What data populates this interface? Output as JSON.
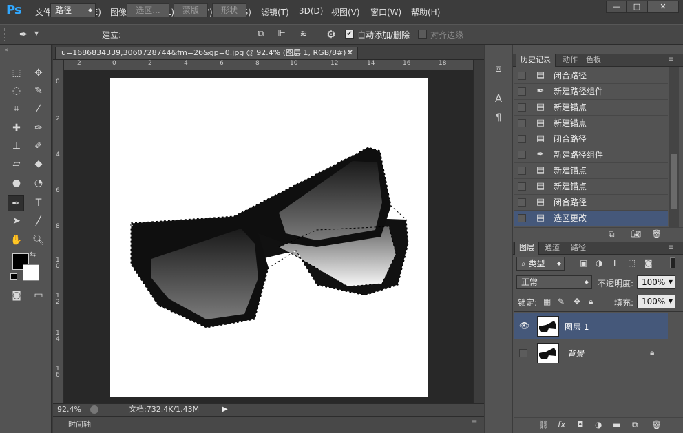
{
  "app": {
    "logo": "Ps"
  },
  "menu": [
    "文件(F)",
    "编辑(E)",
    "图像(I)",
    "图层(L)",
    "文字(Y)",
    "选择(S)",
    "滤镜(T)",
    "3D(D)",
    "视图(V)",
    "窗口(W)",
    "帮助(H)"
  ],
  "window_controls": {
    "minimize": "—",
    "maximize": "□",
    "close": "✕"
  },
  "options": {
    "mode_select": "路径",
    "make_label": "建立:",
    "selection_btn": "选区...",
    "mask_btn": "蒙版",
    "shape_btn": "形状",
    "auto_add_delete": "自动添加/删除",
    "align_edges": "对齐边缘"
  },
  "document": {
    "tab_title": "u=1686834339,3060728744&fm=26&gp=0.jpg @ 92.4% (图层 1, RGB/8#) *",
    "ruler_h_ticks": [
      "2",
      "0",
      "2",
      "4",
      "6",
      "8",
      "10",
      "12",
      "14",
      "16",
      "18"
    ],
    "ruler_v_ticks": [
      "0",
      "2",
      "4",
      "6",
      "8",
      "1 0",
      "1 2",
      "1 4",
      "1 6"
    ],
    "zoom": "92.4%",
    "doc_size": "文档:732.4K/1.43M",
    "timeline_label": "时间轴"
  },
  "history": {
    "tabs": [
      "历史记录",
      "动作",
      "色板"
    ],
    "items": [
      {
        "icon": "doc-icon",
        "label": "闭合路径"
      },
      {
        "icon": "pen-icon",
        "label": "新建路径组件"
      },
      {
        "icon": "doc-icon",
        "label": "新建锚点"
      },
      {
        "icon": "doc-icon",
        "label": "新建锚点"
      },
      {
        "icon": "doc-icon",
        "label": "闭合路径"
      },
      {
        "icon": "pen-icon",
        "label": "新建路径组件"
      },
      {
        "icon": "doc-icon",
        "label": "新建锚点"
      },
      {
        "icon": "doc-icon",
        "label": "新建锚点"
      },
      {
        "icon": "doc-icon",
        "label": "闭合路径"
      },
      {
        "icon": "doc-icon",
        "label": "选区更改"
      }
    ],
    "selected_index": 9
  },
  "layers": {
    "tabs": [
      "图层",
      "通道",
      "路径"
    ],
    "filter_kind": "类型",
    "blend_mode": "正常",
    "opacity_label": "不透明度:",
    "opacity": "100%",
    "lock_label": "锁定:",
    "fill_label": "填充:",
    "fill": "100%",
    "items": [
      {
        "name": "图层 1",
        "visible": true,
        "selected": true
      },
      {
        "name": "背景",
        "visible": false,
        "selected": false,
        "locked": true
      }
    ]
  },
  "colors": {
    "selected_row": "#45587a",
    "ps_blue": "#31a8ff"
  }
}
